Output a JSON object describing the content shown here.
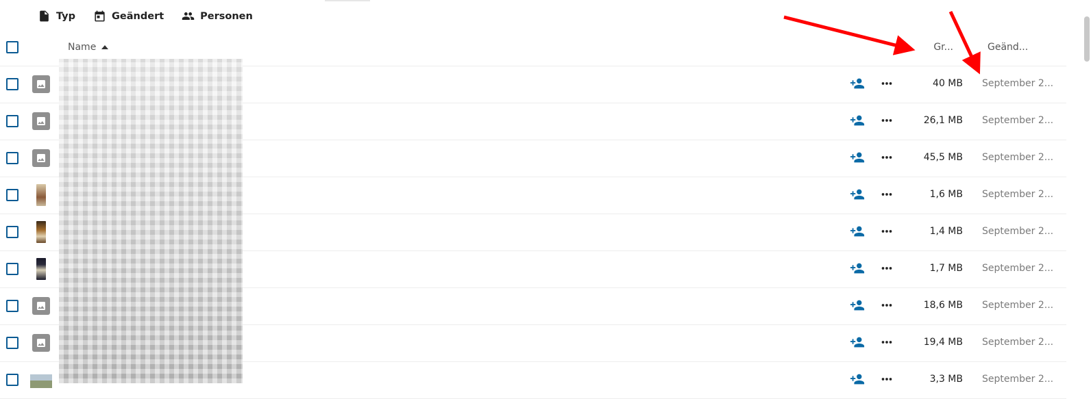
{
  "filters": [
    {
      "label": "Typ",
      "icon": "document-icon"
    },
    {
      "label": "Geändert",
      "icon": "calendar-icon"
    },
    {
      "label": "Personen",
      "icon": "people-icon"
    }
  ],
  "table": {
    "header": {
      "name": "Name",
      "size": "Gr...",
      "modified": "Geänd..."
    },
    "rows": [
      {
        "thumb": "image-generic",
        "size": "40 MB",
        "modified": "September 2..."
      },
      {
        "thumb": "image-generic",
        "size": "26,1 MB",
        "modified": "September 2..."
      },
      {
        "thumb": "image-generic",
        "size": "45,5 MB",
        "modified": "September 2..."
      },
      {
        "thumb": "photo",
        "size": "1,6 MB",
        "modified": "September 2..."
      },
      {
        "thumb": "photo",
        "size": "1,4 MB",
        "modified": "September 2..."
      },
      {
        "thumb": "photo",
        "size": "1,7 MB",
        "modified": "September 2..."
      },
      {
        "thumb": "image-generic",
        "size": "18,6 MB",
        "modified": "September 2..."
      },
      {
        "thumb": "image-generic",
        "size": "19,4 MB",
        "modified": "September 2..."
      },
      {
        "thumb": "landscape",
        "size": "3,3 MB",
        "modified": "September 2..."
      }
    ]
  },
  "colors": {
    "accent": "#0b5a93",
    "annotation_arrow": "#ff0000"
  }
}
